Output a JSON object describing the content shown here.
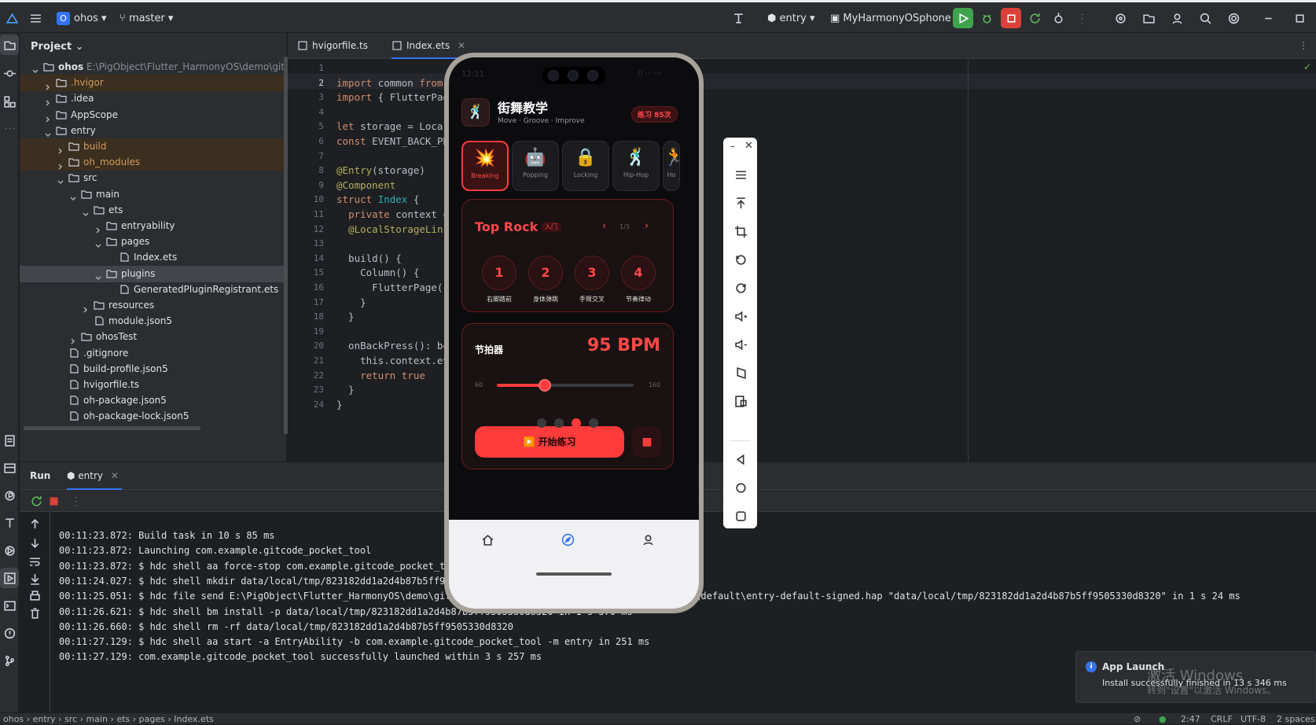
{
  "ide": {
    "project_badge": "O",
    "project_name": "ohos",
    "branch": "master",
    "run_config": "entry",
    "device": "MyHarmonyOSphone",
    "panel_title": "Project",
    "tabs": [
      {
        "label": "hvigorfile.ts"
      },
      {
        "label": "Index.ets"
      }
    ],
    "tree": [
      {
        "label": "ohos",
        "extra": "E:\\PigObject\\Flutter_HarmonyOS\\demo\\gitcode_",
        "depth": 0,
        "open": true,
        "hl": false
      },
      {
        "label": ".hvigor",
        "depth": 1,
        "open": false,
        "hl": true
      },
      {
        "label": ".idea",
        "depth": 1,
        "open": false,
        "hl": false
      },
      {
        "label": "AppScope",
        "depth": 1,
        "open": false,
        "hl": false
      },
      {
        "label": "entry",
        "depth": 1,
        "open": true,
        "hl": false
      },
      {
        "label": "build",
        "depth": 2,
        "open": false,
        "hl": true
      },
      {
        "label": "oh_modules",
        "depth": 2,
        "open": false,
        "hl": true
      },
      {
        "label": "src",
        "depth": 2,
        "open": true,
        "hl": false
      },
      {
        "label": "main",
        "depth": 3,
        "open": true,
        "hl": false
      },
      {
        "label": "ets",
        "depth": 4,
        "open": true,
        "hl": false
      },
      {
        "label": "entryability",
        "depth": 5,
        "open": false,
        "hl": false
      },
      {
        "label": "pages",
        "depth": 5,
        "open": true,
        "hl": false
      },
      {
        "label": "Index.ets",
        "depth": 6,
        "file": true,
        "hl": false
      },
      {
        "label": "plugins",
        "depth": 5,
        "open": true,
        "hl": false,
        "sel": true
      },
      {
        "label": "GeneratedPluginRegistrant.ets",
        "depth": 6,
        "file": true,
        "hl": false
      },
      {
        "label": "resources",
        "depth": 4,
        "open": false,
        "hl": false
      },
      {
        "label": "module.json5",
        "depth": 4,
        "file": true,
        "hl": false
      },
      {
        "label": "ohosTest",
        "depth": 3,
        "open": false,
        "hl": false
      },
      {
        "label": ".gitignore",
        "depth": 2,
        "file": true,
        "hl": false
      },
      {
        "label": "build-profile.json5",
        "depth": 2,
        "file": true,
        "hl": false
      },
      {
        "label": "hvigorfile.ts",
        "depth": 2,
        "file": true,
        "hl": false
      },
      {
        "label": "oh-package.json5",
        "depth": 2,
        "file": true,
        "hl": false
      },
      {
        "label": "oh-package-lock.json5",
        "depth": 2,
        "file": true,
        "hl": false
      }
    ],
    "code_lines": [
      "",
      "import common from",
      "import { FlutterPag",
      "",
      "let storage = Local",
      "const EVENT_BACK_PR",
      "",
      "@Entry(storage)",
      "@Component",
      "struct Index {",
      "  private context =",
      "  @LocalStorageLink",
      "",
      "  build() {",
      "    Column() {",
      "      FlutterPage({",
      "    }",
      "  }",
      "",
      "  onBackPress(): bo",
      "    this.context.ev",
      "    return true",
      "  }",
      "}"
    ],
    "run_tab": "Run",
    "run_config_tab": "entry",
    "log_lines": [
      "00:11:23.872: Build task in 10 s 85 ms",
      "00:11:23.872: Launching com.example.gitcode_pocket_tool",
      "00:11:23.872: $ hdc shell aa force-stop com.example.gitcode_pocket_t",
      "00:11:24.027: $ hdc shell mkdir data/local/tmp/823182dd1a2d4b87b5ff9",
      "00:11:25.051: $ hdc file send E:\\PigObject\\Flutter_HarmonyOS\\demo\\git                                      tputs\\default\\entry-default-signed.hap \"data/local/tmp/823182dd1a2d4b87b5ff9505330d8320\" in 1 s 24 ms",
      "00:11:26.621: $ hdc shell bm install -p data/local/tmp/823182dd1a2d4b87b5ff9505330d8320 in 1 s 570 ms",
      "00:11:26.660: $ hdc shell rm -rf data/local/tmp/823182dd1a2d4b87b5ff9505330d8320",
      "00:11:27.129: $ hdc shell aa start -a EntryAbility -b com.example.gitcode_pocket_tool -m entry in 251 ms",
      "00:11:27.129: com.example.gitcode_pocket_tool successfully launched within 3 s 257 ms"
    ],
    "breadcrumb": [
      "ohos",
      "entry",
      "src",
      "main",
      "ets",
      "pages",
      "Index.ets"
    ],
    "status_right": {
      "pos": "2:47",
      "eol": "CRLF",
      "enc": "UTF-8",
      "indent": "2 spaces"
    },
    "toast": {
      "title": "App Launch",
      "body": "Install successfully finished in 13 s 346 ms",
      "watermark1": "激活 Windows",
      "watermark2": "转到\"设置\"以激活 Windows。"
    }
  },
  "app": {
    "status_time": "12:11",
    "title": "街舞教学",
    "subtitle": "Move · Groove · Improve",
    "badge": "练习 85次",
    "categories": [
      {
        "emoji": "💥",
        "label": "Breaking",
        "active": true
      },
      {
        "emoji": "🤖",
        "label": "Popping",
        "active": false
      },
      {
        "emoji": "🔒",
        "label": "Locking",
        "active": false
      },
      {
        "emoji": "🕺",
        "label": "Hip-Hop",
        "active": false
      },
      {
        "emoji": "🏃",
        "label": "Ho",
        "active": false
      }
    ],
    "move": {
      "name": "Top Rock",
      "level": "入门",
      "page": "1/3",
      "steps": [
        {
          "n": "1",
          "label": "右脚踏前"
        },
        {
          "n": "2",
          "label": "身体弹跳"
        },
        {
          "n": "3",
          "label": "手臂交叉"
        },
        {
          "n": "4",
          "label": "节奏律动"
        }
      ]
    },
    "metronome": {
      "label": "节拍器",
      "bpm_text": "95 BPM",
      "min": "60",
      "max": "160",
      "value": 95,
      "range": [
        60,
        160
      ],
      "active_beat": 3,
      "beats": 4
    },
    "start_button": "▶️ 开始练习",
    "accent": "#ff3b3b"
  },
  "colors": {
    "accent": "#ff3b3b",
    "ide_bg": "#1e1f22",
    "panel_bg": "#2b2d30",
    "highlight": "#3b2f1f",
    "run_green": "#3fa34d",
    "stop_red": "#d9413a"
  }
}
